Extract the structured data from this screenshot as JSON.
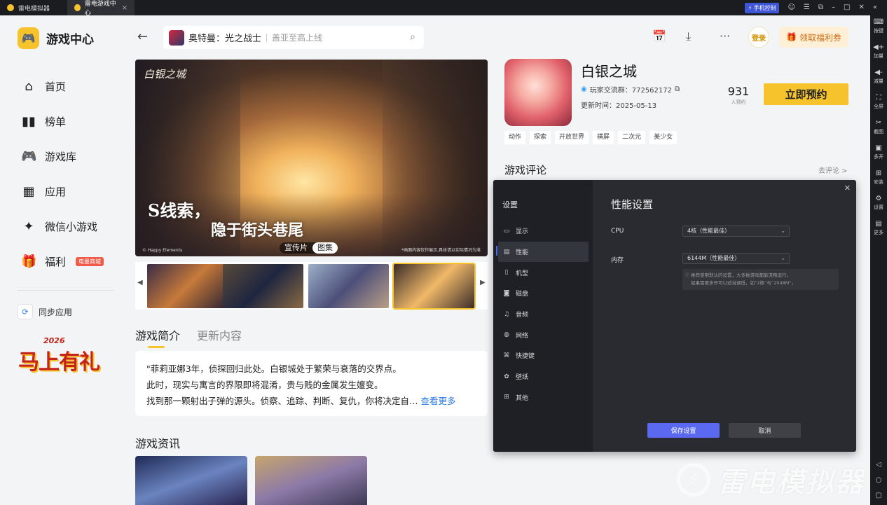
{
  "titlebar": {
    "tabs": [
      {
        "label": "雷电模拟器"
      },
      {
        "label": "雷电游戏中心"
      }
    ],
    "phone_control": "手机控制"
  },
  "right_toolbar": {
    "items": [
      {
        "icon": "keyboard-icon",
        "label": "按键"
      },
      {
        "icon": "volume-up-icon",
        "label": "加量"
      },
      {
        "icon": "volume-down-icon",
        "label": "减量"
      },
      {
        "icon": "fullscreen-icon",
        "label": "全屏"
      },
      {
        "icon": "scissors-icon",
        "label": "截图"
      },
      {
        "icon": "multi-window-icon",
        "label": "多开"
      },
      {
        "icon": "install-icon",
        "label": "安装"
      },
      {
        "icon": "settings-gear-icon",
        "label": "设置"
      },
      {
        "icon": "more-icon",
        "label": "更多"
      }
    ]
  },
  "sidebar": {
    "app_title": "游戏中心",
    "nav": [
      {
        "label": "首页",
        "icon": "home-icon"
      },
      {
        "label": "榜单",
        "icon": "ranking-icon"
      },
      {
        "label": "游戏库",
        "icon": "gamepad-icon"
      },
      {
        "label": "应用",
        "icon": "apps-icon"
      },
      {
        "label": "微信小游戏",
        "icon": "wechat-game-icon"
      },
      {
        "label": "福利",
        "icon": "gift-icon",
        "badge": "电量商城"
      }
    ],
    "sync_label": "同步应用",
    "promo_year": "2026",
    "promo_text": "马上有礼"
  },
  "header": {
    "search_title": "奥特曼：光之战士",
    "search_subtitle": "盖亚至高上线",
    "login_label": "登录",
    "welfare_label": "领取福利券"
  },
  "banner": {
    "logo_text": "白银之城",
    "line1": "线索，",
    "line1_initial": "S",
    "line2": "隐于街头巷尾",
    "copyright": "© Happy Elements",
    "note": "*画面内容仅作展示,具体请以实际情况为准",
    "tabs": [
      "宣传片",
      "图集"
    ],
    "active_tab": "图集"
  },
  "intro": {
    "tabs": [
      "游戏简介",
      "更新内容"
    ],
    "lines": [
      "\"菲莉亚娜3年，侦探回归此处。白银城处于繁荣与衰落的交界点。",
      "此时，现实与寓言的界限即将混淆，贵与贱的金属发生嬗变。",
      "找到那一颗射出子弹的源头。侦察、追踪、判断、复仇，你将决定自…"
    ],
    "more_label": "查看更多",
    "news_title": "游戏资讯"
  },
  "game": {
    "name": "白银之城",
    "qq_group": "玩家交流群：772562172",
    "update_time": "更新时间：2025-05-13",
    "reserve_count": "931",
    "reserve_label": "人预约",
    "reserve_button": "立即预约",
    "tags": [
      "动作",
      "探索",
      "开放世界",
      "横屏",
      "二次元",
      "美少女"
    ],
    "review_title": "游戏评论",
    "review_link": "去评论 >"
  },
  "settings_dialog": {
    "sidebar_title": "设置",
    "menu": [
      {
        "label": "显示",
        "icon": "monitor-icon"
      },
      {
        "label": "性能",
        "icon": "performance-icon"
      },
      {
        "label": "机型",
        "icon": "phone-model-icon"
      },
      {
        "label": "磁盘",
        "icon": "disk-icon"
      },
      {
        "label": "音频",
        "icon": "audio-icon"
      },
      {
        "label": "网络",
        "icon": "network-icon"
      },
      {
        "label": "快捷键",
        "icon": "shortcut-icon"
      },
      {
        "label": "壁纸",
        "icon": "wallpaper-icon"
      },
      {
        "label": "其他",
        "icon": "other-icon"
      }
    ],
    "active_menu": "性能",
    "title": "性能设置",
    "cpu_label": "CPU",
    "cpu_value": "4核（性能最佳）",
    "memory_label": "内存",
    "memory_value": "6144M（性能最佳）",
    "hint_line1": "推荐使用默认的设置，大多数游戏都能流畅运行。",
    "hint_line2": "如果需要多开可以适当调低，如“2核”与“2048M”。",
    "save_label": "保存设置",
    "cancel_label": "取消"
  },
  "watermark": {
    "text": "雷电模拟器"
  }
}
